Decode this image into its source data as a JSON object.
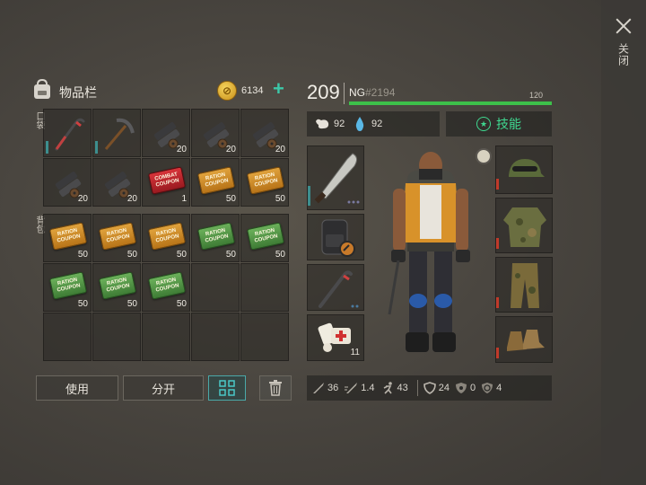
{
  "header": {
    "title": "物品栏",
    "coins": "6134",
    "add": "+"
  },
  "side_labels": {
    "pocket": "口袋",
    "backpack": "背包"
  },
  "pocket_slots": [
    {
      "item": "crowbar-icon",
      "count": ""
    },
    {
      "item": "pickaxe-icon",
      "count": ""
    },
    {
      "item": "gear-bundle-icon",
      "count": "20"
    },
    {
      "item": "gear-bundle-icon",
      "count": "20"
    },
    {
      "item": "gear-bundle-icon",
      "count": "20"
    },
    {
      "item": "gear-bundle-icon",
      "count": "20"
    },
    {
      "item": "gear-bundle-icon",
      "count": "20"
    },
    {
      "item": "red-coupon-icon",
      "count": "1"
    },
    {
      "item": "orange-coupon-icon",
      "count": "50"
    },
    {
      "item": "orange-coupon-icon",
      "count": "50"
    }
  ],
  "backpack_slots": [
    {
      "item": "orange-coupon-icon",
      "count": "50"
    },
    {
      "item": "orange-coupon-icon",
      "count": "50"
    },
    {
      "item": "orange-coupon-icon",
      "count": "50"
    },
    {
      "item": "green-coupon-icon",
      "count": "50"
    },
    {
      "item": "green-coupon-icon",
      "count": "50"
    },
    {
      "item": "green-coupon-icon",
      "count": "50"
    },
    {
      "item": "green-coupon-icon",
      "count": "50"
    },
    {
      "item": "green-coupon-icon",
      "count": "50"
    },
    {
      "item": "",
      "count": ""
    },
    {
      "item": "",
      "count": ""
    },
    {
      "item": "",
      "count": ""
    },
    {
      "item": "",
      "count": ""
    },
    {
      "item": "",
      "count": ""
    },
    {
      "item": "",
      "count": ""
    },
    {
      "item": "",
      "count": ""
    }
  ],
  "buttons": {
    "use": "使用",
    "split": "分开"
  },
  "player": {
    "level": "209",
    "name": "NG",
    "tag": "#2194",
    "hp": "120",
    "food": "92",
    "water": "92",
    "skills": "技能"
  },
  "equipment": {
    "first_aid_count": "11"
  },
  "stats": {
    "attack": "36",
    "attack_speed": "1.4",
    "speed": "43",
    "armor": "24",
    "radiation": "0",
    "poison": "4"
  },
  "close": {
    "label": "关闭"
  },
  "colors": {
    "accent": "#3cc8a8",
    "hp": "#3dc04a",
    "skills": "#3fd890",
    "durability_low": "#c03a2a",
    "durability": "#3d8e8e"
  }
}
